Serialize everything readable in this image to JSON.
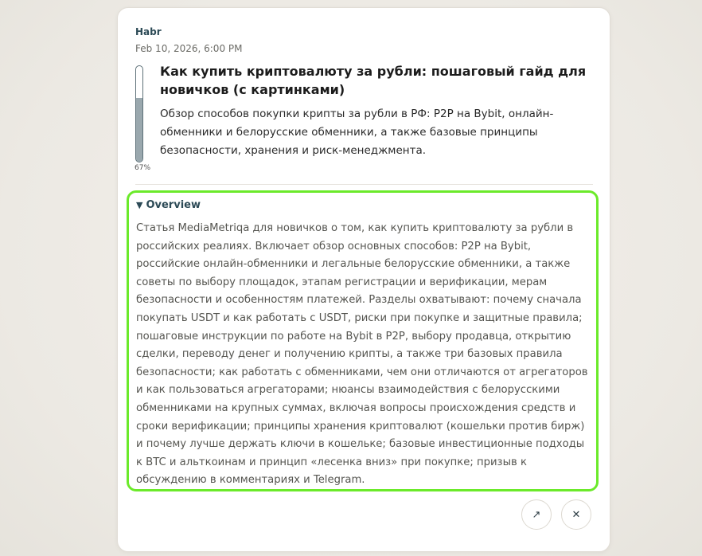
{
  "card": {
    "source": "Habr",
    "date": "Feb 10, 2026, 6:00 PM",
    "progress_percent": 67,
    "progress_label": "67%",
    "title": "Как купить криптовалюту за рубли: пошаговый гайд для новичков (с картинками)",
    "description": "Обзор способов покупки крипты за рубли в РФ: P2P на Bybit, онлайн-обменники и белорусские обменники, а также базовые принципы безопасности, хранения и риск-менеджмента."
  },
  "overview": {
    "toggle_glyph": "▼",
    "label": "Overview",
    "text": "Статья MediaMetriqa для новичков о том, как купить криптовалюту за рубли в российских реалиях. Включает обзор основных способов: P2P на Bybit, российские онлайн-обменники и легальные белорусские обменники, а также советы по выбору площадок, этапам регистрации и верификации, мерам безопасности и особенностям платежей. Разделы охватывают: почему сначала покупать USDT и как работать с USDT, риски при покупке и защитные правила; пошаговые инструкции по работе на Bybit в P2P, выбору продавца, открытию сделки, переводу денег и получению крипты, а также три базовых правила безопасности; как работать с обменниками, чем они отличаются от агрегаторов и как пользоваться агрегаторами; нюансы взаимодействия с белорусскими обменниками на крупных суммах, включая вопросы происхождения средств и сроки верификации; принципы хранения криптовалют (кошельки против бирж) и почему лучше держать ключи в кошельке; базовые инвестиционные подходы к BTC и альткоинам и принцип «лесенка вниз» при покупке; призыв к обсуждению в комментариях и Telegram."
  },
  "actions": {
    "open_glyph": "↗",
    "close_glyph": "✕"
  },
  "colors": {
    "highlight_border": "#6bea2a",
    "accent_text": "#2c4a56"
  }
}
